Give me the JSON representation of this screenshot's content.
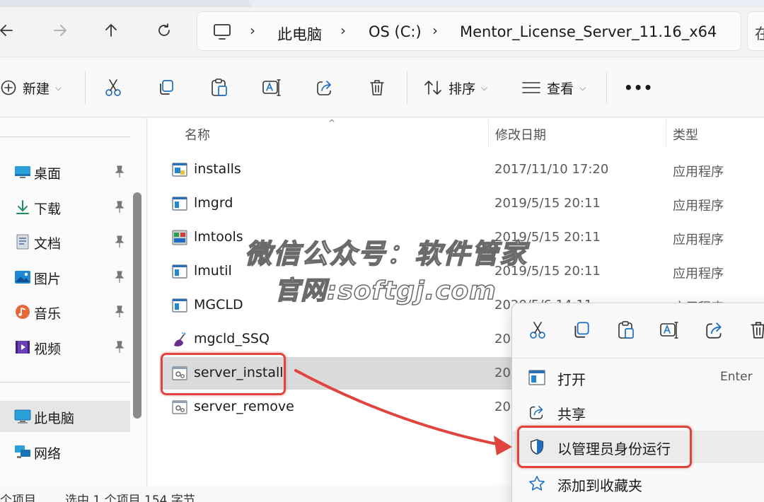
{
  "nav": {
    "back_icon": "arrow-left-icon",
    "forward_icon": "arrow-right-icon",
    "up_icon": "arrow-up-icon",
    "refresh_icon": "refresh-icon"
  },
  "breadcrumb": [
    "此电脑",
    "OS (C:)",
    "Mentor_License_Server_11.16_x64"
  ],
  "search": {
    "placeholder": "在"
  },
  "toolbar": {
    "new_label": "新建",
    "sort_label": "排序",
    "view_label": "查看",
    "more_label": "•••"
  },
  "sidebar": {
    "items": [
      {
        "label": "桌面",
        "icon": "desktop-icon",
        "pinned": true
      },
      {
        "label": "下载",
        "icon": "download-icon",
        "pinned": true
      },
      {
        "label": "文档",
        "icon": "document-icon",
        "pinned": true
      },
      {
        "label": "图片",
        "icon": "picture-icon",
        "pinned": true
      },
      {
        "label": "音乐",
        "icon": "music-icon",
        "pinned": true
      },
      {
        "label": "视频",
        "icon": "video-icon",
        "pinned": true
      },
      {
        "label": "此电脑",
        "icon": "computer-icon",
        "pinned": false,
        "selected": true
      },
      {
        "label": "网络",
        "icon": "network-icon",
        "pinned": false
      }
    ]
  },
  "columns": {
    "name": "名称",
    "date": "修改日期",
    "type": "类型"
  },
  "files": [
    {
      "name": "installs",
      "date": "2017/11/10 17:20",
      "type": "应用程序"
    },
    {
      "name": "lmgrd",
      "date": "2019/5/15 20:11",
      "type": "应用程序"
    },
    {
      "name": "lmtools",
      "date": "2019/5/15 20:11",
      "type": "应用程序"
    },
    {
      "name": "lmutil",
      "date": "2019/5/15 20:11",
      "type": "应用程序"
    },
    {
      "name": "MGCLD",
      "date": "2020/5/6 14:11",
      "type": "应用程序"
    },
    {
      "name": "mgcld_SSQ",
      "date": "20",
      "type": ""
    },
    {
      "name": "server_install",
      "date": "20",
      "type": "",
      "selected": true
    },
    {
      "name": "server_remove",
      "date": "20",
      "type": ""
    }
  ],
  "status": {
    "count": "个项目",
    "selection": "选中 1 个项目  154 字节"
  },
  "context_menu": {
    "items": [
      {
        "label": "打开",
        "shortcut": "Enter",
        "icon": "open-icon"
      },
      {
        "label": "共享",
        "shortcut": "",
        "icon": "share-icon"
      },
      {
        "label": "以管理员身份运行",
        "shortcut": "",
        "icon": "shield-icon",
        "highlighted": true
      },
      {
        "label": "添加到收藏夹",
        "shortcut": "",
        "icon": "star-icon"
      }
    ]
  },
  "watermark": {
    "line1": "微信公众号：软件管家",
    "line2": "官网:softgj.com"
  },
  "colors": {
    "annotation": "#e0443e",
    "accent": "#0067c0"
  }
}
